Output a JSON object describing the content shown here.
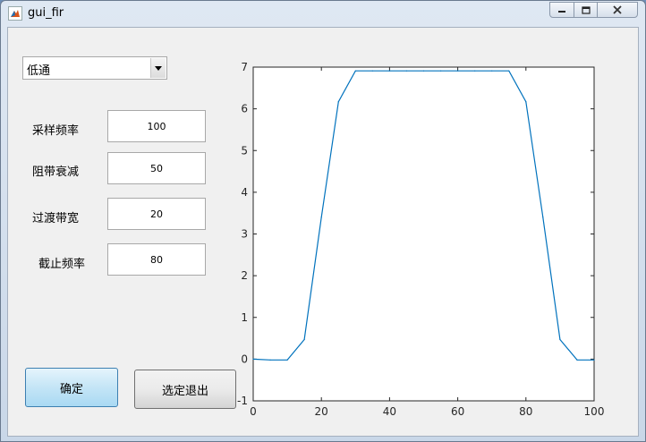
{
  "window": {
    "title": "gui_fir"
  },
  "filter_select": {
    "value": "低通"
  },
  "fields": [
    {
      "label": "采样频率",
      "value": "100"
    },
    {
      "label": "阻带衰减",
      "value": "50"
    },
    {
      "label": "过渡带宽",
      "value": "20"
    },
    {
      "label": "截止频率",
      "value": "80"
    }
  ],
  "buttons": {
    "confirm": "确定",
    "exit": "选定退出"
  },
  "chart_data": {
    "type": "line",
    "x": [
      0,
      5,
      10,
      15,
      20,
      25,
      30,
      35,
      40,
      45,
      50,
      55,
      60,
      65,
      70,
      75,
      80,
      85,
      90,
      95,
      100
    ],
    "series": [
      {
        "values": [
          0,
          -0.02,
          -0.02,
          0.47,
          3.4,
          6.17,
          6.91,
          6.91,
          6.91,
          6.91,
          6.91,
          6.91,
          6.91,
          6.91,
          6.91,
          6.91,
          6.17,
          3.4,
          0.47,
          -0.02,
          -0.02
        ]
      }
    ],
    "xlim": [
      0,
      100
    ],
    "ylim": [
      -1,
      7
    ],
    "xticks": [
      0,
      20,
      40,
      60,
      80,
      100
    ],
    "yticks": [
      -1,
      0,
      1,
      2,
      3,
      4,
      5,
      6,
      7
    ],
    "line_color": "#0072bd",
    "grid": false
  }
}
